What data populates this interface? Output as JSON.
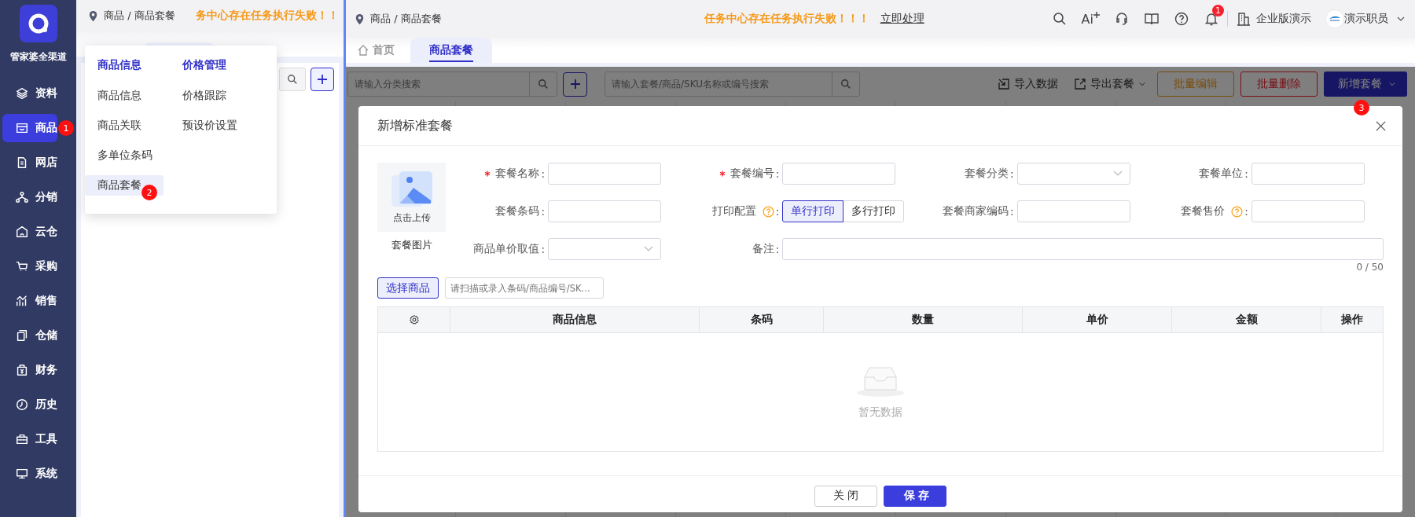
{
  "left_panel": {
    "sidebar": {
      "brand": "管家婆全渠道",
      "items": [
        {
          "label": "资料",
          "selected": false
        },
        {
          "label": "商品",
          "selected": true,
          "marker": "1"
        },
        {
          "label": "网店",
          "selected": false
        },
        {
          "label": "分销",
          "selected": false
        },
        {
          "label": "云仓",
          "selected": false
        },
        {
          "label": "采购",
          "selected": false
        },
        {
          "label": "销售",
          "selected": false
        },
        {
          "label": "仓储",
          "selected": false
        },
        {
          "label": "财务",
          "selected": false
        },
        {
          "label": "历史",
          "selected": false
        },
        {
          "label": "工具",
          "selected": false
        },
        {
          "label": "系统",
          "selected": false
        }
      ]
    },
    "breadcrumb": "商品 / 商品套餐",
    "alert": "务中心存在任务执行失败！！",
    "menu": {
      "columns": [
        {
          "heading": "商品信息",
          "items": [
            {
              "label": "商品信息",
              "selected": false
            },
            {
              "label": "商品关联",
              "selected": false
            },
            {
              "label": "多单位条码",
              "selected": false
            },
            {
              "label": "商品套餐",
              "selected": true,
              "marker": "2"
            }
          ]
        },
        {
          "heading": "价格管理",
          "items": [
            {
              "label": "价格跟踪",
              "selected": false
            },
            {
              "label": "预设价设置",
              "selected": false
            }
          ]
        }
      ]
    }
  },
  "right_panel": {
    "breadcrumb": "商品 / 商品套餐",
    "alert": "任务中心存在任务执行失败！！！",
    "alert_action": "立即处理",
    "ai_label": "Ai",
    "notification_count": "1",
    "company": "企业版演示",
    "user": "演示职员",
    "tabs": [
      {
        "label": "首页",
        "selected": false
      },
      {
        "label": "商品套餐",
        "selected": true
      }
    ],
    "toolbar": {
      "category_search": {
        "placeholder": "请输入分类搜索"
      },
      "package_search": {
        "placeholder": "请输入套餐/商品/SKU名称或编号搜索"
      },
      "actions": [
        {
          "label": "导入数据",
          "kind": "import"
        },
        {
          "label": "导出套餐",
          "kind": "export"
        },
        {
          "label": "批量编辑",
          "kind": "warning"
        },
        {
          "label": "批量删除",
          "kind": "danger"
        },
        {
          "label": "新增套餐",
          "kind": "primary",
          "marker": "3"
        }
      ]
    },
    "dialog": {
      "title": "新增标准套餐",
      "upload": {
        "hint": "点击上传",
        "caption": "套餐图片"
      },
      "fields": [
        {
          "label": "套餐名称",
          "colon": ":",
          "kind": "input",
          "required": true,
          "help": false
        },
        {
          "label": "套餐编号",
          "colon": ":",
          "kind": "input",
          "required": true,
          "help": false
        },
        {
          "label": "套餐分类",
          "colon": ":",
          "kind": "select",
          "required": false,
          "help": false
        },
        {
          "label": "套餐单位",
          "colon": ":",
          "kind": "input",
          "required": false,
          "help": false
        },
        {
          "label": "套餐条码",
          "colon": ":",
          "kind": "input",
          "required": false,
          "help": false
        },
        {
          "label": "打印配置",
          "colon": ":",
          "kind": "toggle",
          "required": false,
          "help": true,
          "options": [
            {
              "label": "单行打印",
              "selected": true
            },
            {
              "label": "多行打印",
              "selected": false
            }
          ]
        },
        {
          "label": "套餐商家编码",
          "colon": ":",
          "kind": "input",
          "required": false,
          "help": false
        },
        {
          "label": "套餐售价",
          "colon": ":",
          "kind": "input",
          "required": false,
          "help": true
        },
        {
          "label": "商品单价取值",
          "colon": ":",
          "kind": "select",
          "required": false,
          "help": false
        },
        {
          "label": "备注",
          "colon": ":",
          "kind": "textarea",
          "required": false,
          "help": false,
          "counter": "0 / 50"
        }
      ],
      "select_button": "选择商品",
      "scan": {
        "placeholder": "请扫描或录入条码/商品编号/SK..."
      },
      "table": {
        "columns": [
          "商品信息",
          "条码",
          "数量",
          "单价",
          "金额",
          "操作"
        ],
        "empty": "暂无数据"
      },
      "buttons": [
        {
          "label": "关 闭",
          "kind": "secondary"
        },
        {
          "label": "保 存",
          "kind": "primary"
        }
      ]
    }
  }
}
